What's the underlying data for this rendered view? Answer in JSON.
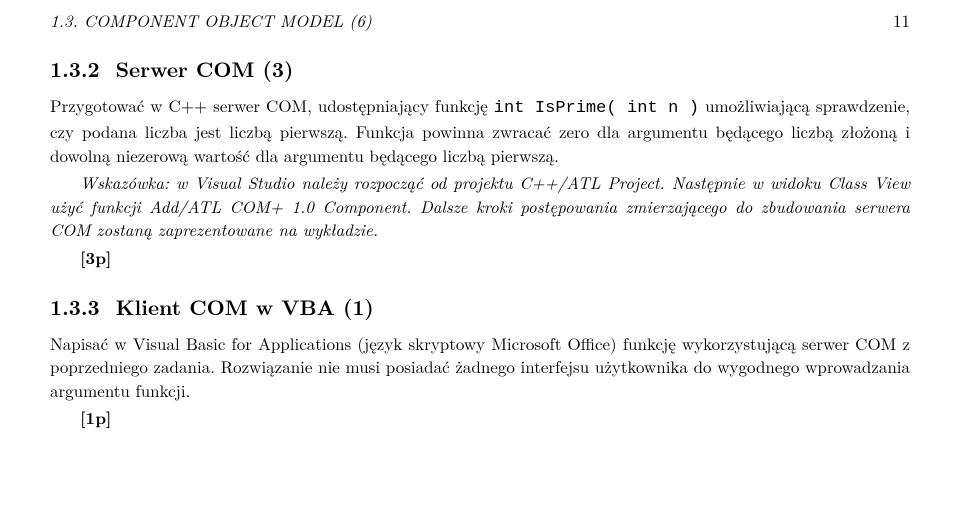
{
  "header": {
    "left": "1.3. COMPONENT OBJECT MODEL (6)",
    "right": "11"
  },
  "sec132": {
    "num": "1.3.2",
    "title": "Serwer COM (3)",
    "p1a": "Przygotować w C++ serwer COM, udostępniający funkcję ",
    "p1code": "int IsPrime( int n )",
    "p1b": " umożliwiającą sprawdzenie, czy podana liczba jest liczbą pierwszą. Funkcja powinna zwracać zero dla argumentu będącego liczbą złożoną i dowolną niezerową wartość dla argumentu będącego liczbą pierwszą.",
    "hint": "Wskazówka: w Visual Studio należy rozpocząć od projektu C++/ATL Project. Następnie w widoku Class View użyć funkcji Add/ATL COM+ 1.0 Component. Dalsze kroki postępowania zmierzającego do zbudowania serwera COM zostaną zaprezentowane na wykładzie.",
    "points": "[3p]"
  },
  "sec133": {
    "num": "1.3.3",
    "title": "Klient COM w VBA (1)",
    "p1": "Napisać w Visual Basic for Applications (język skryptowy Microsoft Office) funkcję wykorzystującą serwer COM z poprzedniego zadania. Rozwiązanie nie musi posiadać żadnego interfejsu użytkownika do wygodnego wprowadzania argumentu funkcji.",
    "points": "[1p]"
  }
}
